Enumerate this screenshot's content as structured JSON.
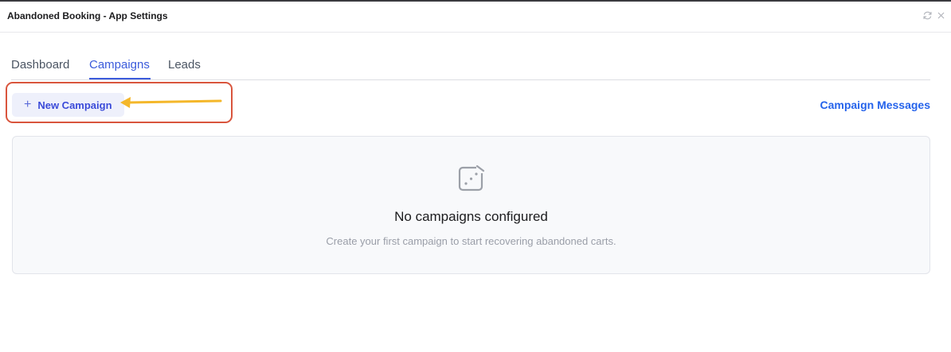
{
  "window": {
    "title": "Abandoned Booking - App Settings",
    "icons": [
      "refresh-icon",
      "close-icon"
    ]
  },
  "tabs": [
    {
      "label": "Dashboard",
      "active": false
    },
    {
      "label": "Campaigns",
      "active": true
    },
    {
      "label": "Leads",
      "active": false
    }
  ],
  "toolbar": {
    "new_campaign_label": "New Campaign",
    "campaign_messages_label": "Campaign Messages"
  },
  "empty_state": {
    "icon": "dice-icon",
    "title": "No campaigns configured",
    "subtitle": "Create your first campaign to start recovering abandoned carts."
  },
  "colors": {
    "accent": "#3b5bdb",
    "link": "#2563eb",
    "highlight_border": "#d9553d",
    "arrow": "#f4b72a"
  }
}
